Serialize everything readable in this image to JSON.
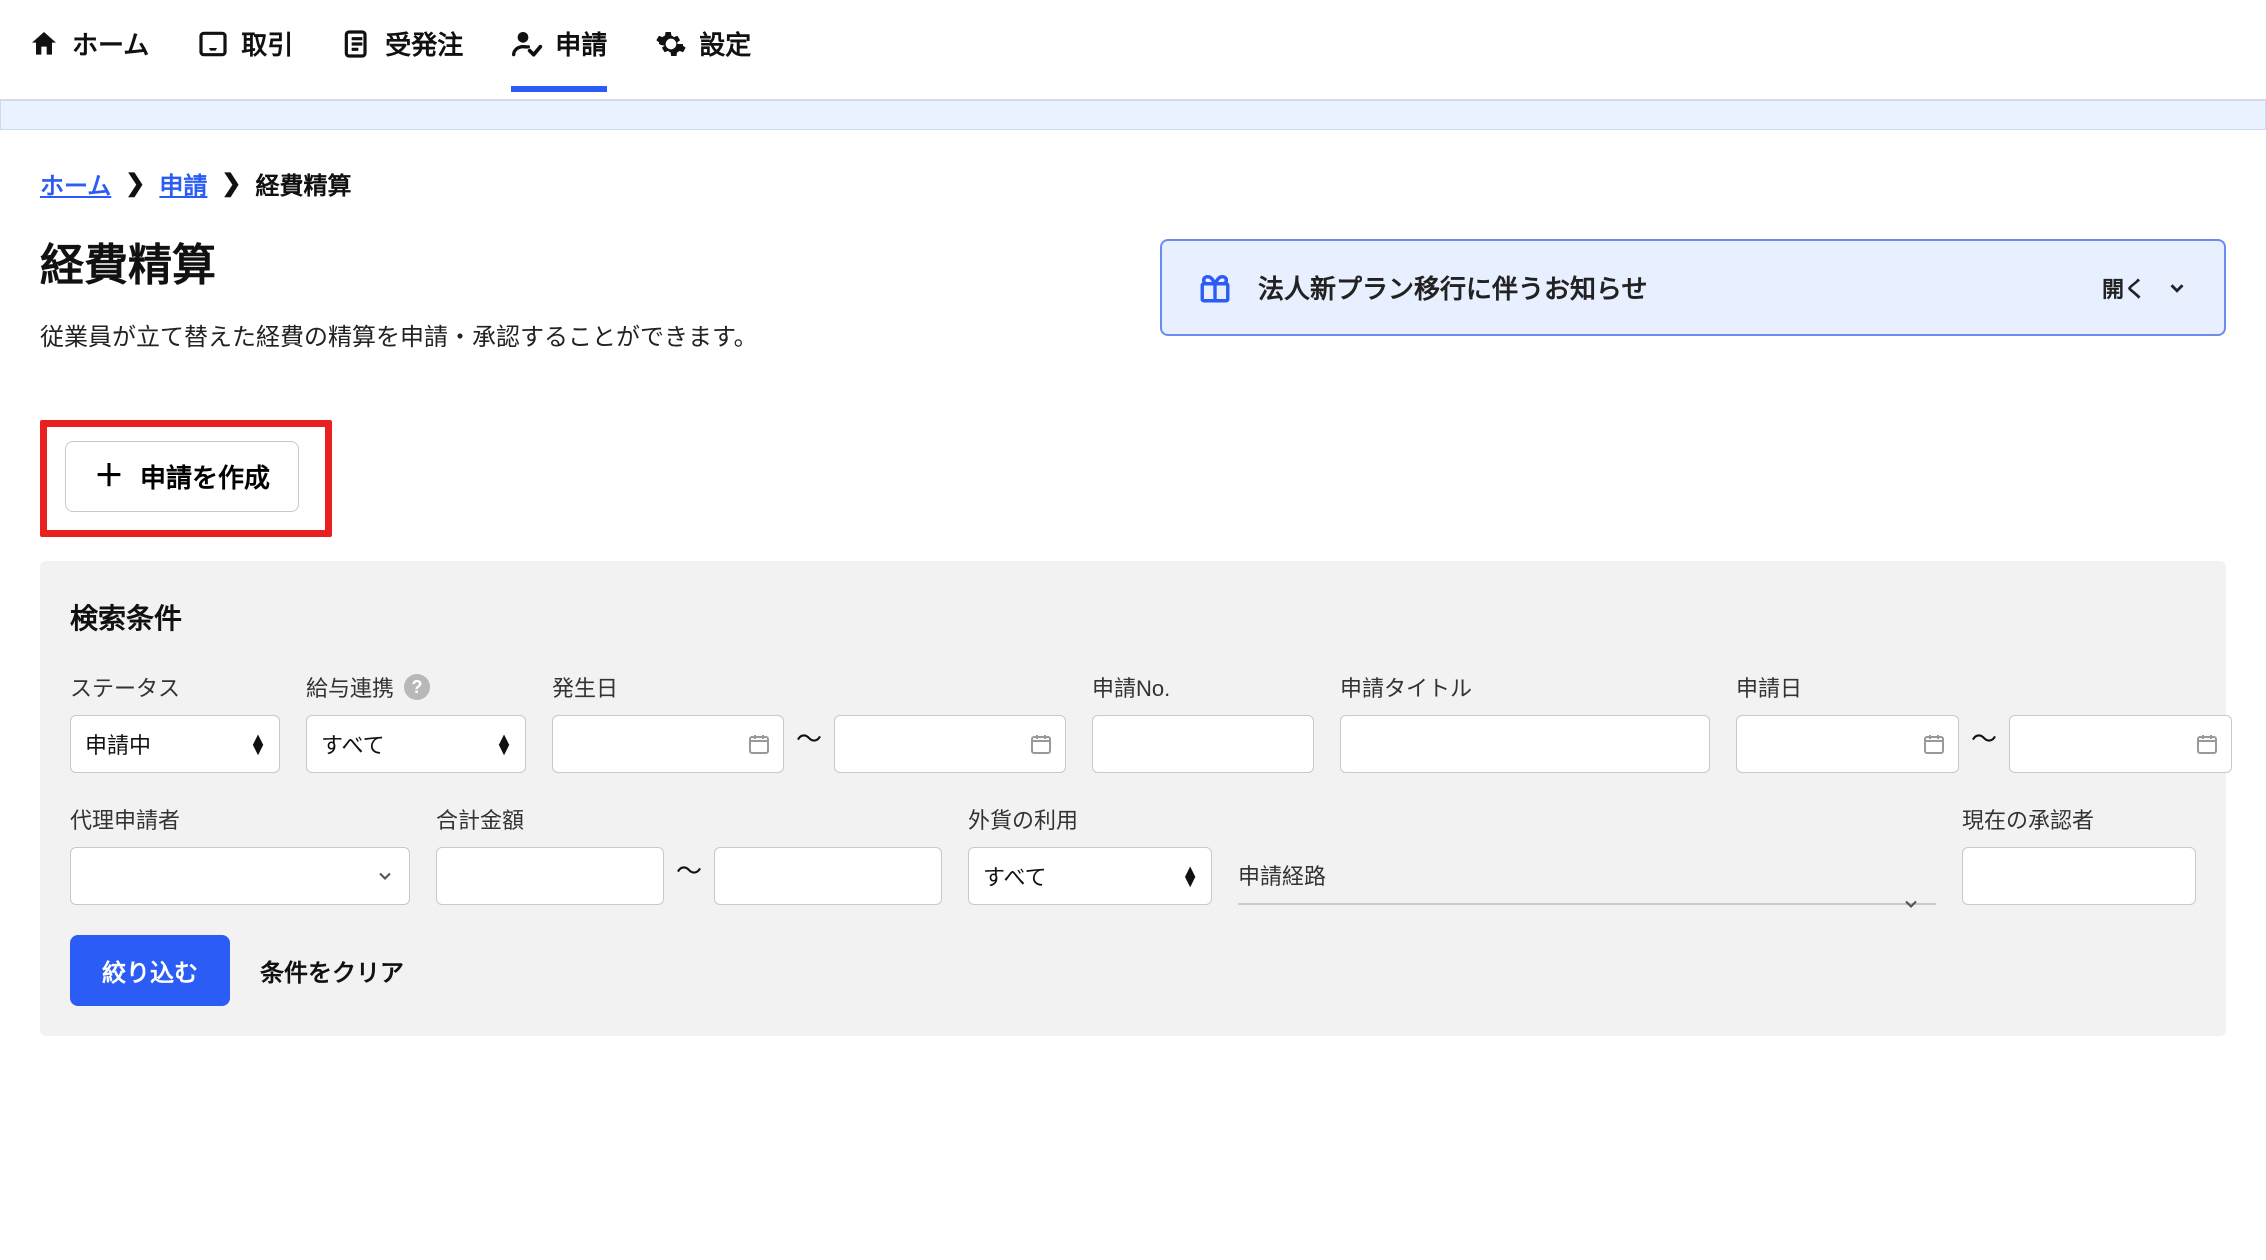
{
  "nav": {
    "items": [
      {
        "label": "ホーム",
        "icon": "home"
      },
      {
        "label": "取引",
        "icon": "tray"
      },
      {
        "label": "受発注",
        "icon": "doc"
      },
      {
        "label": "申請",
        "icon": "person-check",
        "active": true
      },
      {
        "label": "設定",
        "icon": "gear"
      }
    ]
  },
  "breadcrumb": {
    "items": [
      {
        "label": "ホーム",
        "link": true
      },
      {
        "label": "申請",
        "link": true
      },
      {
        "label": "経費精算",
        "link": false
      }
    ]
  },
  "page": {
    "title": "経費精算",
    "description": "従業員が立て替えた経費の精算を申請・承認することができます。"
  },
  "notice": {
    "text": "法人新プラン移行に伴うお知らせ",
    "expand_label": "開く"
  },
  "create_button": {
    "label": "申請を作成"
  },
  "search": {
    "heading": "検索条件",
    "status": {
      "label": "ステータス",
      "value": "申請中"
    },
    "payroll": {
      "label": "給与連携",
      "value": "すべて"
    },
    "occur_date": {
      "label": "発生日"
    },
    "app_no": {
      "label": "申請No."
    },
    "app_title": {
      "label": "申請タイトル"
    },
    "app_date": {
      "label": "申請日"
    },
    "agent": {
      "label": "代理申請者"
    },
    "total": {
      "label": "合計金額"
    },
    "foreign": {
      "label": "外貨の利用",
      "value": "すべて"
    },
    "route": {
      "label": "申請経路"
    },
    "approver": {
      "label": "現在の承認者"
    },
    "filter_btn": "絞り込む",
    "clear_btn": "条件をクリア",
    "range_sep": "〜"
  }
}
